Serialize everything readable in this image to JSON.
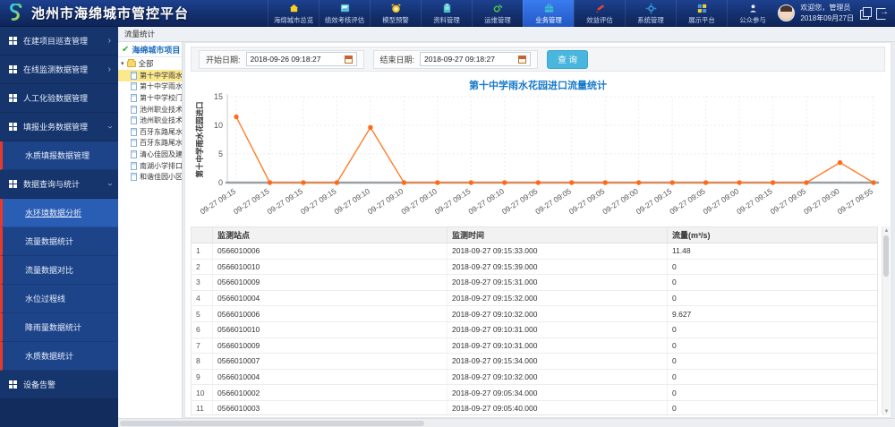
{
  "app": {
    "title": "池州市海绵城市管控平台"
  },
  "header": {
    "welcome": "欢迎您，管理员",
    "date": "2018年09月27日",
    "nav": [
      {
        "key": "overview",
        "label": "海绵城市总览",
        "icon": "home-icon",
        "active": false
      },
      {
        "key": "performance-eval",
        "label": "绩效考核评估",
        "icon": "report-icon",
        "active": false
      },
      {
        "key": "model-alert",
        "label": "模型预警",
        "icon": "alarm-icon",
        "active": false
      },
      {
        "key": "document-mgmt",
        "label": "资料管理",
        "icon": "clipboard-icon",
        "active": false
      },
      {
        "key": "operation-mgmt",
        "label": "运维管理",
        "icon": "maintenance-icon",
        "active": false
      },
      {
        "key": "business-mgmt",
        "label": "业务管理",
        "icon": "briefcase-icon",
        "active": true
      },
      {
        "key": "benefit-eval",
        "label": "效益评估",
        "icon": "pencil-icon",
        "active": false
      },
      {
        "key": "system-mgmt",
        "label": "系统管理",
        "icon": "gear-icon",
        "active": false
      },
      {
        "key": "display-platform",
        "label": "展示平台",
        "icon": "grid-icon",
        "active": false
      },
      {
        "key": "public-participation",
        "label": "公众参与",
        "icon": "public-icon",
        "active": false
      }
    ]
  },
  "sidebar": {
    "items": [
      {
        "key": "project-inspection",
        "label": "在建项目巡查管理",
        "level": 1,
        "arrow": "right",
        "accent": false,
        "active": false
      },
      {
        "key": "online-monitoring",
        "label": "在线监测数据管理",
        "level": 1,
        "arrow": "right",
        "accent": false,
        "active": false
      },
      {
        "key": "manual-test-data",
        "label": "人工化验数据管理",
        "level": 1,
        "arrow": "",
        "accent": false,
        "active": false
      },
      {
        "key": "report-business-data",
        "label": "填报业务数据管理",
        "level": 1,
        "arrow": "down",
        "accent": false,
        "active": false
      },
      {
        "key": "water-quality-report",
        "label": "水质填报数据管理",
        "level": 2,
        "arrow": "",
        "accent": true,
        "active": false
      },
      {
        "key": "data-query-stats",
        "label": "数据查询与统计",
        "level": 1,
        "arrow": "down",
        "accent": false,
        "active": false
      },
      {
        "key": "water-env-analysis",
        "label": "水环境数据分析",
        "level": 2,
        "arrow": "",
        "accent": true,
        "active": true
      },
      {
        "key": "flow-stats",
        "label": "流量数据统计",
        "level": 2,
        "arrow": "",
        "accent": true,
        "active": false
      },
      {
        "key": "flow-compare",
        "label": "流量数据对比",
        "level": 2,
        "arrow": "",
        "accent": true,
        "active": false
      },
      {
        "key": "water-level-curve",
        "label": "水位过程线",
        "level": 2,
        "arrow": "",
        "accent": true,
        "active": false
      },
      {
        "key": "rainfall-stats",
        "label": "降雨量数据统计",
        "level": 2,
        "arrow": "",
        "accent": true,
        "active": false
      },
      {
        "key": "water-quality-stats",
        "label": "水质数据统计",
        "level": 2,
        "arrow": "",
        "accent": true,
        "active": false
      },
      {
        "key": "device-alarm",
        "label": "设备告警",
        "level": 1,
        "arrow": "",
        "accent": false,
        "active": false
      }
    ]
  },
  "tree_panel": {
    "tab_label": "流量统计",
    "header": "海绵城市项目",
    "root": "全部",
    "items": [
      {
        "label": "第十中学雨水花",
        "selected": true
      },
      {
        "label": "第十中学雨水花",
        "selected": false
      },
      {
        "label": "第十中学校门口",
        "selected": false
      },
      {
        "label": "池州职业技术下",
        "selected": false
      },
      {
        "label": "池州职业技术下",
        "selected": false
      },
      {
        "label": "百牙东路尾水湿",
        "selected": false
      },
      {
        "label": "百牙东路尾水湿",
        "selected": false
      },
      {
        "label": "清心佳园及建国",
        "selected": false
      },
      {
        "label": "南湖小学排口",
        "selected": false
      },
      {
        "label": "和谐佳园小区门",
        "selected": false
      }
    ]
  },
  "filters": {
    "start_label": "开始日期:",
    "start_value": "2018-09-26 09:18:27",
    "end_label": "结束日期:",
    "end_value": "2018-09-27 09:18:27",
    "search_label": "查 询"
  },
  "chart_data": {
    "type": "line",
    "title": "第十中学雨水花园进口流量统计",
    "ylabel": "第十中学雨水花园进口",
    "ylim": [
      0,
      15
    ],
    "yticks": [
      0,
      5,
      10,
      15
    ],
    "grid": true,
    "line_color": "#ff7f2e",
    "marker_color": "#ff6a1a",
    "categories": [
      "09-27 09:15",
      "09-27 09:15",
      "09-27 09:15",
      "09-27 09:15",
      "09-27 09:10",
      "09-27 09:10",
      "09-27 09:10",
      "09-27 09:15",
      "09-27 09:10",
      "09-27 09:05",
      "09-27 09:05",
      "09-27 09:05",
      "09-27 09:00",
      "09-27 09:15",
      "09-27 09:05",
      "09-27 09:00",
      "09-27 09:15",
      "09-27 09:05",
      "09-27 09:00",
      "09-27 08:55"
    ],
    "values": [
      11.48,
      0,
      0,
      0,
      9.627,
      0,
      0,
      0,
      0,
      0,
      0,
      0,
      0,
      0,
      0,
      0,
      0,
      0,
      3.5,
      0
    ]
  },
  "table": {
    "columns": [
      "监测站点",
      "监测时间",
      "流量(m³/s)"
    ],
    "rows": [
      [
        "1",
        "0566010006",
        "2018-09-27 09:15:33.000",
        "11.48"
      ],
      [
        "2",
        "0566010010",
        "2018-09-27 09:15:39.000",
        "0"
      ],
      [
        "3",
        "0566010009",
        "2018-09-27 09:15:31.000",
        "0"
      ],
      [
        "4",
        "0566010004",
        "2018-09-27 09:15:32.000",
        "0"
      ],
      [
        "5",
        "0566010006",
        "2018-09-27 09:10:32.000",
        "9.627"
      ],
      [
        "6",
        "0566010010",
        "2018-09-27 09:10:31.000",
        "0"
      ],
      [
        "7",
        "0566010009",
        "2018-09-27 09:10:31.000",
        "0"
      ],
      [
        "8",
        "0566010007",
        "2018-09-27 09:15:34.000",
        "0"
      ],
      [
        "9",
        "0566010004",
        "2018-09-27 09:10:32.000",
        "0"
      ],
      [
        "10",
        "0566010002",
        "2018-09-27 09:05:34.000",
        "0"
      ],
      [
        "11",
        "0566010003",
        "2018-09-27 09:05:40.000",
        "0"
      ]
    ]
  }
}
